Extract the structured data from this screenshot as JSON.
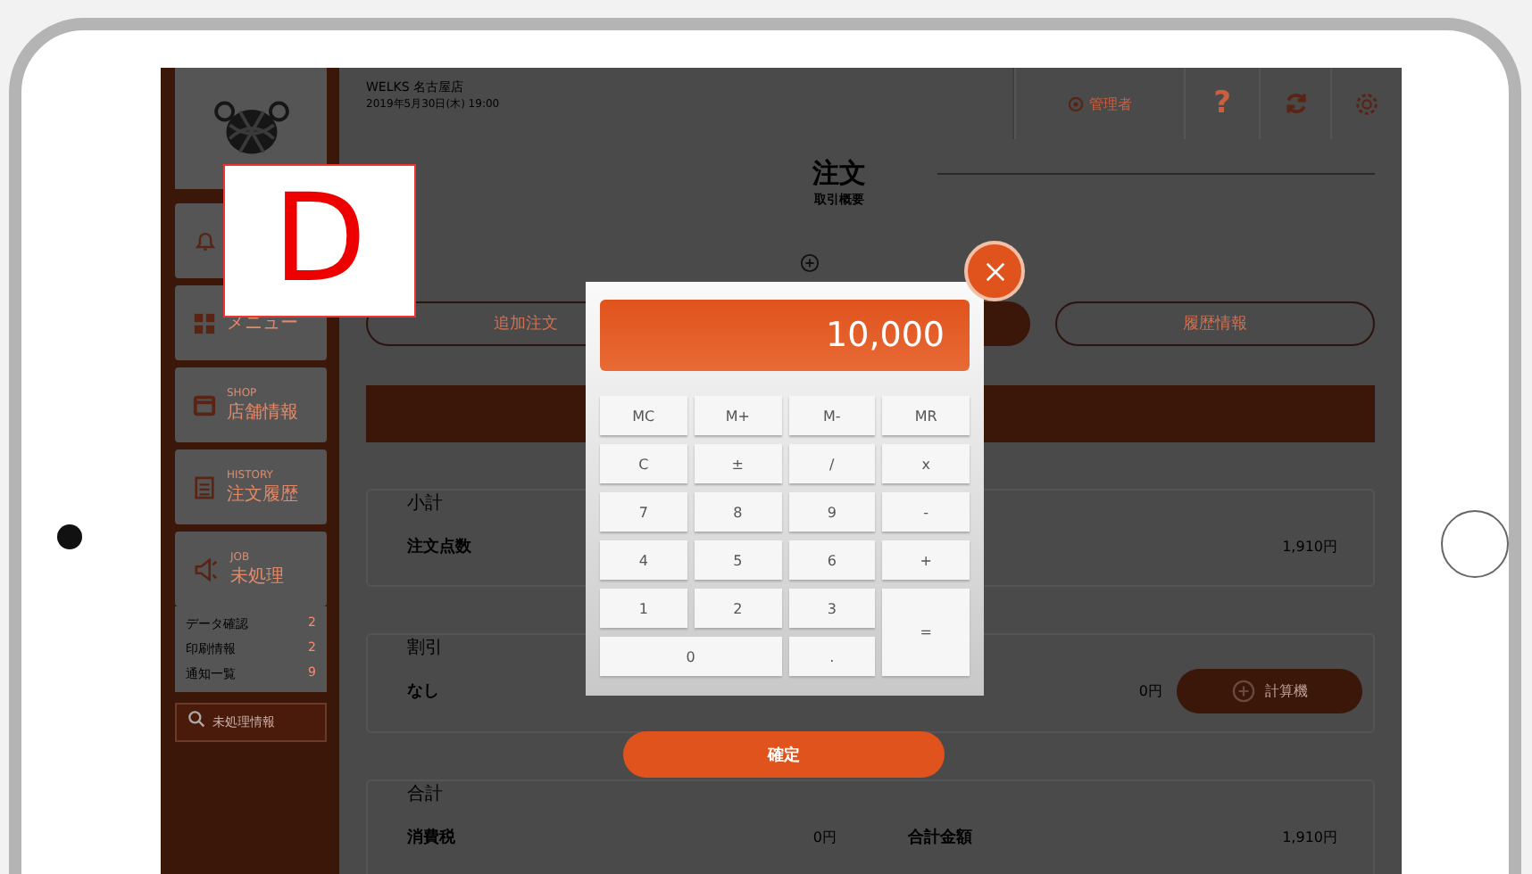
{
  "marker_label": "D",
  "header": {
    "store": "WELKS 名古屋店",
    "datetime": "2019年5月30日(木) 19:00",
    "user_button": "管理者",
    "help_button": "?"
  },
  "sidebar": {
    "items": [
      {
        "kind": "bell"
      },
      {
        "kind": "menu",
        "label": "メニュー"
      },
      {
        "kind": "shop",
        "caption": "SHOP",
        "label": "店舗情報"
      },
      {
        "kind": "history",
        "caption": "HISTORY",
        "label": "注文履歴"
      },
      {
        "kind": "job",
        "caption": "JOB",
        "label": "未処理"
      }
    ],
    "counts": [
      {
        "label": "データ確認",
        "count": "2"
      },
      {
        "label": "印刷情報",
        "count": "2"
      },
      {
        "label": "通知一覧",
        "count": "9"
      }
    ],
    "search": {
      "placeholder": "未処理情報"
    }
  },
  "page": {
    "title": "注文",
    "subtitle": "取引概要"
  },
  "tabs": [
    {
      "label": "追加注文",
      "selected": false
    },
    {
      "selected": true
    },
    {
      "label": "履歴情報",
      "selected": false
    }
  ],
  "sections": [
    {
      "title": "小計",
      "rows": [
        {
          "label": "注文点数",
          "value": "1,910円"
        }
      ]
    },
    {
      "title": "割引",
      "rows": [
        {
          "label": "なし",
          "value": "0円",
          "button": "計算機"
        }
      ]
    },
    {
      "title": "合計",
      "rows": [
        {
          "label": "消費税",
          "value": "0円"
        },
        {
          "label": "合計金額",
          "value": "1,910円"
        }
      ]
    }
  ],
  "calculator": {
    "display": "10,000",
    "confirm": "確定",
    "keys": [
      {
        "label": "MC",
        "kind": "key"
      },
      {
        "label": "M+",
        "kind": "key"
      },
      {
        "label": "M-",
        "kind": "key"
      },
      {
        "label": "MR",
        "kind": "key"
      },
      {
        "label": "C",
        "kind": "key"
      },
      {
        "label": "±",
        "kind": "key"
      },
      {
        "label": "/",
        "kind": "key"
      },
      {
        "label": "x",
        "kind": "key"
      },
      {
        "label": "7",
        "kind": "key"
      },
      {
        "label": "8",
        "kind": "key"
      },
      {
        "label": "9",
        "kind": "key"
      },
      {
        "label": "-",
        "kind": "key"
      },
      {
        "label": "4",
        "kind": "key"
      },
      {
        "label": "5",
        "kind": "key"
      },
      {
        "label": "6",
        "kind": "key"
      },
      {
        "label": "+",
        "kind": "key"
      },
      {
        "label": "1",
        "kind": "key"
      },
      {
        "label": "2",
        "kind": "key"
      },
      {
        "label": "3",
        "kind": "key"
      },
      {
        "label": "=",
        "kind": "tall"
      },
      {
        "label": "0",
        "kind": "wide"
      },
      {
        "label": ".",
        "kind": "key"
      }
    ]
  }
}
